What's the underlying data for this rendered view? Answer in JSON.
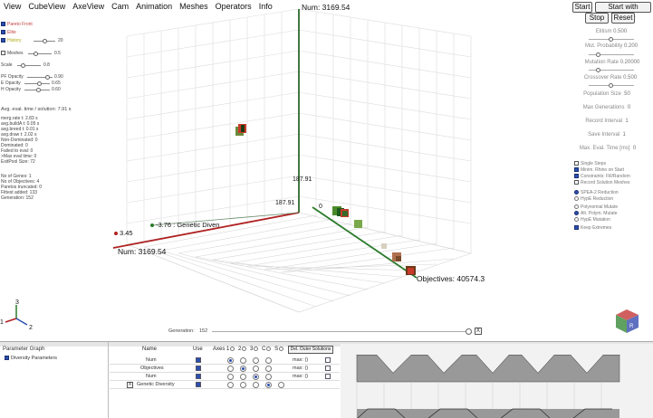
{
  "menu": [
    "View",
    "CubeView",
    "AxeView",
    "Cam",
    "Animation",
    "Meshes",
    "Operators",
    "Info"
  ],
  "buttons": {
    "start": "Start",
    "start_presets": "Start with Presets",
    "stop": "Stop",
    "reset": "Reset"
  },
  "left_panel": {
    "legend": [
      {
        "label": "Pareto Front",
        "color": "#d04040"
      },
      {
        "label": "Elite",
        "color": "#d04040"
      },
      {
        "label": "History",
        "color": "#c8c020",
        "slider_value": "20"
      }
    ],
    "meshes_label": "Meshes",
    "meshes_value": "0.5",
    "scale_label": "Scale",
    "scale_value": "0.8",
    "opacities": [
      {
        "label": "PF Opacity",
        "value": "0.90"
      },
      {
        "label": "E Opacity",
        "value": "0.65"
      },
      {
        "label": "H Opacity",
        "value": "0.60"
      }
    ],
    "avg_eval": "Avg. eval. time / solution: 7.91 s",
    "stats": [
      "merg.rate t: 2.83 s",
      "avg.buildA t: 0.05 s",
      "avg.breed t: 0.01 s",
      "avg.draw t: 2.02 s",
      "Non-Dominated: 0",
      "Dominated: 0",
      "Failed to eval: 0",
      ">Max eval time: 0",
      "ExitPool Size: 72"
    ],
    "genes": [
      "No of Genes: 1",
      "No of Objectives: 4",
      "Paretos truncated: 0",
      "Fittest added: 133",
      "Generation: 152"
    ]
  },
  "plot": {
    "axis_top_label": "Num: 3169.54",
    "axis_left_label": "Num: 3169.54",
    "axis_right_label": "Objectives: 40574.3",
    "diversity_label": "-3.76 : Genetic Diven",
    "val_345": "3.45",
    "val_18791_a": "187.91",
    "val_18791_b": "187.91",
    "val_0": "0"
  },
  "generation": {
    "label": "Generation:",
    "value": "152",
    "close": "X"
  },
  "axis_gizmo": {
    "x": "1",
    "y": "2",
    "z": "3"
  },
  "right_panel": {
    "elitism": {
      "label": "Elitism",
      "value": "0.500"
    },
    "mut_prob": {
      "label": "Mut. Probability",
      "value": "0.200"
    },
    "mut_rate": {
      "label": "Mutation Rate",
      "value": "0.20000"
    },
    "cross_rate": {
      "label": "Crossover Rate",
      "value": "0.500"
    },
    "pop_size": {
      "label": "Population Size",
      "value": "50"
    },
    "max_gen": {
      "label": "Max Generations",
      "value": "0"
    },
    "record_interval": {
      "label": "Record Interval",
      "value": "1"
    },
    "save_interval": {
      "label": "Save Interval",
      "value": "1"
    },
    "max_eval": {
      "label": "Max. Eval. Time [ms]",
      "value": "0"
    },
    "checks": [
      {
        "label": "Single Steps",
        "on": false
      },
      {
        "label": "Minim. Rhino on Start",
        "on": true
      },
      {
        "label": "Constraints: Fill/Random",
        "on": true
      },
      {
        "label": "Record Solution Meshes",
        "on": false
      }
    ],
    "reduction": [
      {
        "label": "SPEA-2 Reduction",
        "on": true
      },
      {
        "label": "HypE Reduction",
        "on": false
      }
    ],
    "mutation": [
      {
        "label": "Polynomial Mutate",
        "on": false
      },
      {
        "label": "Alt. Polym. Mutate",
        "on": true
      },
      {
        "label": "HypE Mutation",
        "on": false
      }
    ],
    "keep_extremes": {
      "label": "Keep Extremes",
      "on": true
    }
  },
  "bottom": {
    "param_graph_label": "Parameter Graph",
    "diversity_params_label": "Diversity Parameters",
    "table_headers": {
      "name": "Name",
      "use": "Use",
      "axes": "Axes",
      "a1": "1",
      "a2": "2",
      "a3": "3",
      "ac": "C",
      "as": "S"
    },
    "del_button": "Del. Outer Solutions",
    "rows": [
      {
        "name": "Num",
        "max": "max: ()"
      },
      {
        "name": "Objectives",
        "max": "max: ()"
      },
      {
        "name": "Num",
        "max": "max: ()"
      },
      {
        "name": "Genetic Diversity",
        "max": ""
      }
    ],
    "row_x": "X"
  }
}
